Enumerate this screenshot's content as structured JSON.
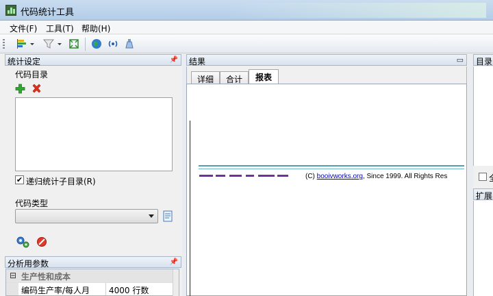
{
  "window": {
    "title": "代码统计工具"
  },
  "menu": [
    {
      "label": "文件(F)"
    },
    {
      "label": "工具(T)"
    },
    {
      "label": "帮助(H)"
    }
  ],
  "toolbar": {
    "buttons": [
      {
        "icon": "bar-chart-icon"
      },
      {
        "icon": "dropdown-arrow-icon"
      },
      {
        "icon": "filter-icon"
      },
      {
        "icon": "dropdown-arrow-icon"
      },
      {
        "icon": "fullscreen-icon"
      },
      {
        "icon": "globe-icon"
      },
      {
        "icon": "broadcast-icon"
      },
      {
        "icon": "bottle-icon"
      }
    ]
  },
  "left_panel": {
    "title": "统计设定",
    "dir_group_label": "代码目录",
    "recurse_label": "递归统计子目录(R)",
    "recurse_checked": "✔",
    "type_group_label": "代码类型",
    "type_selected": ""
  },
  "analysis_panel": {
    "title": "分析用参数",
    "category": "生产性和成本",
    "collapse_glyph": "⊟",
    "rows": [
      {
        "name": "编码生产率/每人月",
        "value": "4000 行数"
      }
    ]
  },
  "result_panel": {
    "title": "结果",
    "tabs": [
      {
        "label": "详细"
      },
      {
        "label": "合计"
      },
      {
        "label": "报表"
      }
    ],
    "active_tab": "报表",
    "copyright_prefix": "(C) ",
    "copyright_link": "booivworks.org",
    "copyright_suffix": ", Since 1999. All Rights Res"
  },
  "right_panel": {
    "title_top": "目录",
    "checkbox_label": "全",
    "title_bottom": "扩展"
  },
  "colors": {
    "accent": "#4fa0b0",
    "panel_border": "#a9b5c4"
  }
}
